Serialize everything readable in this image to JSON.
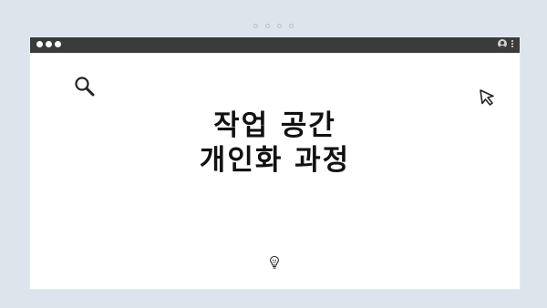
{
  "title": {
    "line1": "작업 공간",
    "line2": "개인화 과정"
  },
  "icons": {
    "search": "search-icon",
    "cursor": "cursor-icon",
    "lightbulb": "lightbulb-icon",
    "profile": "profile-icon",
    "menu": "kebab-menu-icon"
  },
  "colors": {
    "background": "#dde4ec",
    "titlebar": "#3b3b3b",
    "window": "#ffffff",
    "text": "#111111"
  }
}
